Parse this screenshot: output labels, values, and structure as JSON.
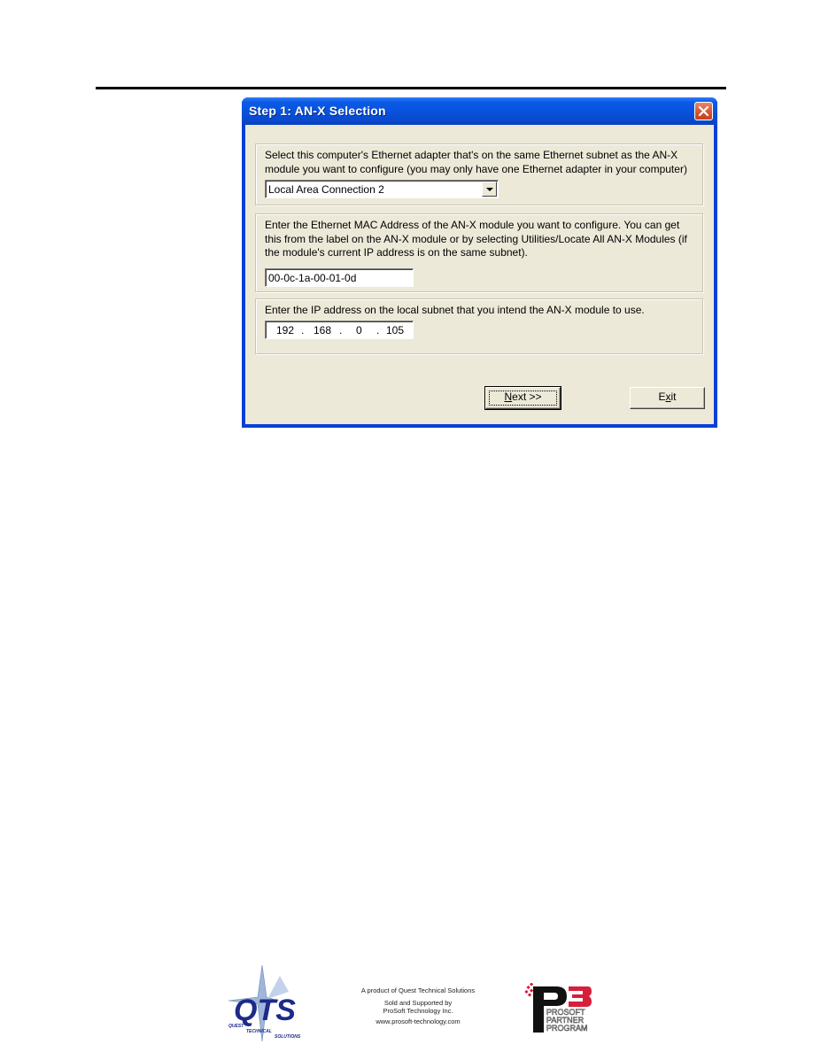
{
  "dialog": {
    "title": "Step 1: AN-X Selection",
    "close_icon": "close-x-icon",
    "adapter_section": {
      "instructions": "Select this computer's Ethernet adapter that's on the same Ethernet subnet as the AN-X module you want to configure (you may only have one Ethernet adapter in your computer)",
      "selected_adapter": "Local Area Connection 2"
    },
    "mac_section": {
      "instructions": "Enter the Ethernet MAC Address of the AN-X module you want to configure. You can get this from the label on the AN-X module or by selecting Utilities/Locate All AN-X Modules (if the module's current IP address is on the same subnet).",
      "mac_value": "00-0c-1a-00-01-0d"
    },
    "ip_section": {
      "instructions": "Enter the IP address on the local subnet that you intend the AN-X module to use.",
      "octets": [
        "192",
        "168",
        "0",
        "105"
      ],
      "separator": "."
    },
    "buttons": {
      "next_accel": "N",
      "next_rest": "ext >>",
      "exit_pre": "E",
      "exit_accel": "x",
      "exit_rest": "it"
    }
  },
  "footer": {
    "line1": "A product of Quest Technical Solutions",
    "line2": "Sold and Supported by",
    "line3": "ProSoft Technology Inc.",
    "line4": "www.prosoft-technology.com",
    "qts_logo": {
      "letters": "QTS",
      "words": [
        "QUEST",
        "TECHNICAL",
        "SOLUTIONS"
      ]
    },
    "p3_logo": {
      "mark": "P3",
      "lines": [
        "PROSOFT",
        "PARTNER",
        "PROGRAM"
      ]
    }
  },
  "colors": {
    "titlebar": "#0852dc",
    "dialog_face": "#ece9d8",
    "close_button": "#d4532c",
    "qts_navy": "#1d2a8a",
    "p3_red": "#d61f3a"
  }
}
